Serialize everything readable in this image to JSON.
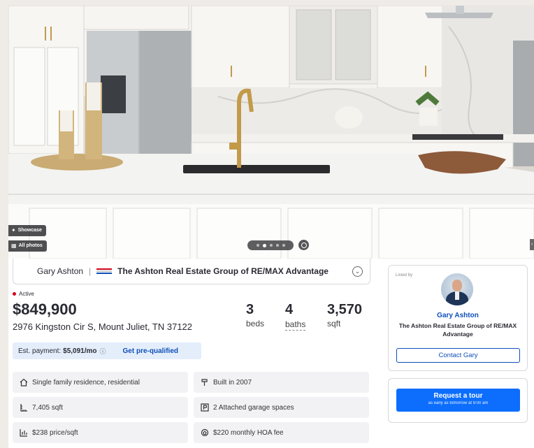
{
  "gallery": {
    "showcase_label": "Showcase",
    "all_photos_label": "All photos",
    "photo_count_dots": 5,
    "active_dot_index": 1
  },
  "agent_bar": {
    "agent_name": "Gary Ashton",
    "separator": "|",
    "brokerage": "The Ashton Real Estate Group of RE/MAX Advantage"
  },
  "listing": {
    "status": "Active",
    "price": "$849,900",
    "address": "2976 Kingston Cir S, Mount Juliet, TN 37122",
    "beds": {
      "value": "3",
      "label": "beds"
    },
    "baths": {
      "value": "4",
      "label": "baths"
    },
    "sqft": {
      "value": "3,570",
      "label": "sqft"
    },
    "payment": {
      "label": "Est. payment:",
      "amount": "$5,091/mo",
      "prequal_link": "Get pre-qualified"
    },
    "facts": [
      {
        "icon": "house-icon",
        "text": "Single family residence, residential"
      },
      {
        "icon": "hammer-icon",
        "text": "Built in 2007"
      },
      {
        "icon": "ruler-icon",
        "text": "7,405 sqft"
      },
      {
        "icon": "parking-icon",
        "text": "2 Attached garage spaces"
      },
      {
        "icon": "price-per-sqft-icon",
        "text": "$238 price/sqft"
      },
      {
        "icon": "hoa-icon",
        "text": "$220 monthly HOA fee"
      }
    ]
  },
  "listed_by_card": {
    "heading": "Listed by",
    "agent_name": "Gary Ashton",
    "agent_firm": "The Ashton Real Estate Group of RE/MAX Advantage",
    "contact_label": "Contact Gary"
  },
  "tour_card": {
    "button_label": "Request a tour",
    "button_sublabel": "as early as tomorrow at 9:00 am"
  },
  "colors": {
    "link_blue": "#0d4fb8",
    "primary_button": "#0d6efd",
    "active_status": "#d0021b",
    "payment_bg": "#e4eefb"
  }
}
